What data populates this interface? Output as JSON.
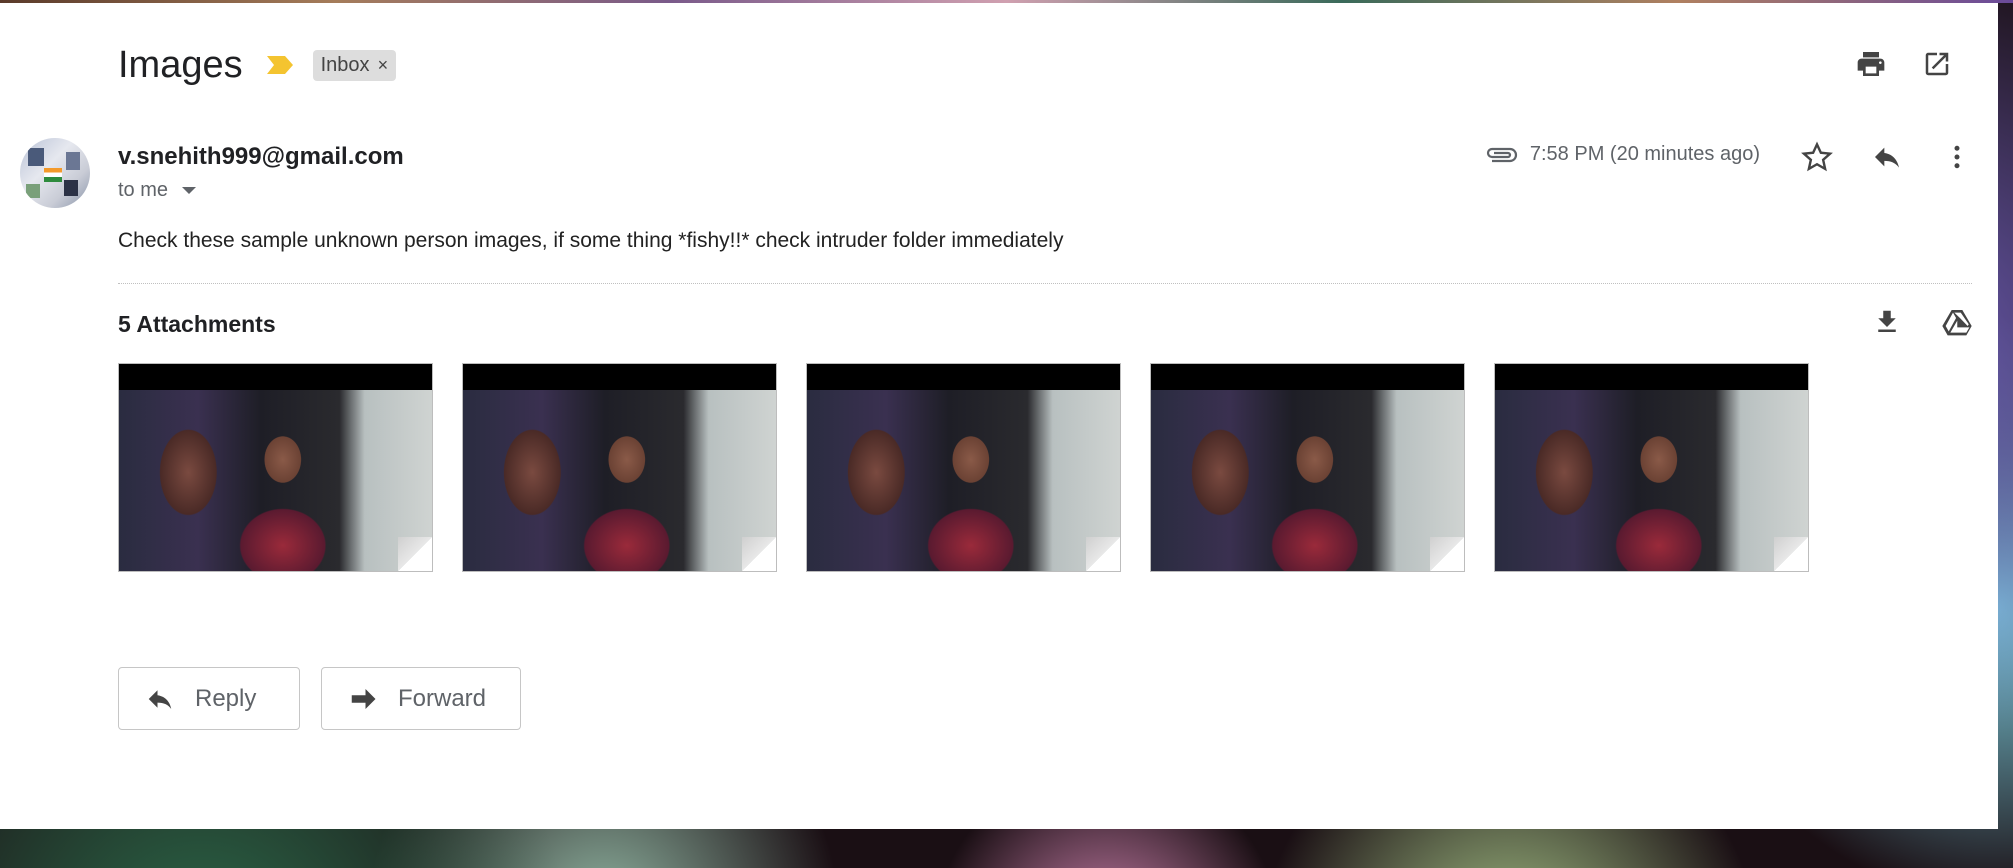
{
  "email": {
    "subject": "Images",
    "label": "Inbox",
    "label_remove": "×",
    "sender": "v.snehith999@gmail.com",
    "recipient": "to me",
    "time": "7:58 PM (20 minutes ago)",
    "body": "Check these sample unknown person images, if some thing *fishy!!* check intruder folder immediately"
  },
  "attachments": {
    "title": "5 Attachments",
    "count": 5
  },
  "actions": {
    "reply_label": "Reply",
    "forward_label": "Forward"
  },
  "icons": {
    "importance": "importance-marker-icon",
    "print": "print-icon",
    "open_new_window": "open-in-new-window-icon",
    "attachment": "paperclip-icon",
    "star": "star-icon",
    "reply": "reply-icon",
    "more": "more-vert-icon",
    "download": "download-icon",
    "drive": "google-drive-icon",
    "forward": "forward-icon"
  },
  "colors": {
    "importance": "#f4c430",
    "chip_bg": "#dddddd",
    "text_primary": "#202124",
    "text_secondary": "#5f6368"
  }
}
